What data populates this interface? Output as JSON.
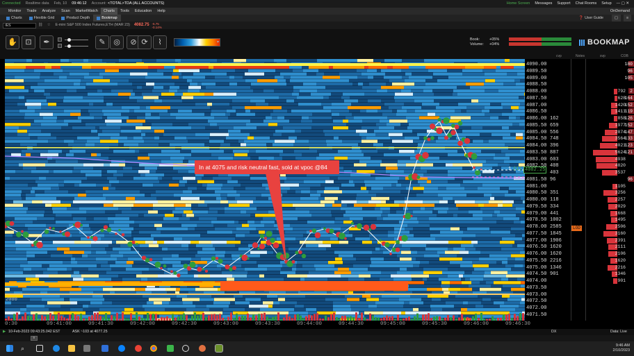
{
  "statusbar": {
    "connected": "Connected",
    "realtime": "Realtime data",
    "date": "Feb, 10",
    "time": "09:46:12",
    "account_label": "Account:",
    "account_value": "<TOTAL>TDA (ALL ACCOUNTS)",
    "home_screen": "Home Screen",
    "messages": "Messages",
    "support": "Support",
    "chat_rooms": "Chat Rooms",
    "setup": "Setup"
  },
  "menu": {
    "tabs": [
      "Monitor",
      "Trade",
      "Analyze",
      "Scan",
      "MarketWatch",
      "Charts",
      "Tools",
      "Education",
      "Help"
    ],
    "active": "Charts",
    "ondemand": "OnDemand"
  },
  "subtabs": {
    "items": [
      "Charts",
      "Flexible Grid",
      "Product Depth",
      "Bookmap"
    ],
    "active": "Bookmap",
    "user_guide": "User Guide"
  },
  "symbol": {
    "value": "/ES",
    "description": "E-mini S&P 500 Index Futures,ETH (MAR 23)",
    "price": "4082.75",
    "change_line1": "-5.75",
    "change_line2": "-0.14%"
  },
  "toolbar": {
    "icons": [
      "hand-icon",
      "crosshair-icon",
      "pin-icon",
      "pencil-icon",
      "ruler-icon",
      "volume-icon",
      "replay-icon",
      "chart-icon"
    ],
    "book_label": "Book:",
    "book_pct": "+05%",
    "volume_label": "Volume:",
    "volume_pct": "+04%",
    "logo": "BOOKMAP"
  },
  "colors": {
    "heat_low": "#04203f",
    "heat_mid": "#1e6fb0",
    "heat_high": "#ffffff",
    "heat_hot": "#ff6a00",
    "bid": "#d9343b",
    "ask": "#2e9c3d",
    "accent": "#3c7fc8"
  },
  "ladder": {
    "headers": {
      "cvp": "cvp",
      "notes": "Notes",
      "svp": "svp",
      "cob": "COB"
    },
    "prices": [
      "4090.00",
      "4089.50",
      "4089.00",
      "4088.50",
      "4088.00",
      "4087.50",
      "4087.00",
      "4086.50",
      "4086.00",
      "4085.50",
      "4085.00",
      "4084.50",
      "4084.00",
      "4083.50",
      "4083.00",
      "4082.50",
      "4082.00",
      "4081.50",
      "4081.00",
      "4080.50",
      "4080.00",
      "4079.50",
      "4079.00",
      "4078.50",
      "4078.00",
      "4077.50",
      "4077.00",
      "4076.50",
      "4076.00",
      "4075.50",
      "4075.00",
      "4074.50",
      "4074.00",
      "4073.50",
      "4073.00",
      "4072.50",
      "4072.00",
      "4071.50"
    ],
    "volumes": [
      "",
      "",
      "",
      "",
      "",
      "",
      "",
      "",
      "162",
      "659",
      "556",
      "748",
      "396",
      "887",
      "603",
      "408",
      "403",
      "96",
      "",
      "351",
      "118",
      "334",
      "441",
      "1002",
      "2585",
      "1845",
      "1906",
      "1620",
      "1620",
      "2216",
      "1346",
      "901",
      "",
      "",
      "",
      "",
      "",
      ""
    ],
    "svp": [
      "",
      "",
      "",
      "",
      "792",
      "628",
      "1420",
      "1411",
      "858",
      "1977",
      "2874",
      "3564",
      "4021",
      "5624",
      "4938",
      "4820",
      "3537",
      "",
      "1105",
      "3256",
      "2257",
      "2029",
      "1668",
      "1495",
      "2506",
      "3160",
      "2391",
      "2111",
      "2106",
      "1620",
      "2216",
      "1346",
      "901",
      "",
      "",
      "",
      "",
      ""
    ],
    "cob": [
      "180",
      "96",
      "105",
      "",
      "2",
      "164",
      "152",
      "119",
      "126",
      "152",
      "147",
      "133",
      "123",
      "121",
      "",
      "",
      "",
      "96",
      "",
      "",
      "",
      "",
      "",
      "",
      "",
      "",
      "",
      "",
      "",
      "",
      "",
      "",
      "",
      "",
      "",
      "",
      "",
      ""
    ],
    "current_price": "4082.25",
    "current_label": "(1)",
    "lod_label": "LOD",
    "annot_1": "1"
  },
  "callout": "In at 4075 and risk neutral fast, sold at vpoc @84",
  "volume_label": "2000",
  "time_axis": [
    "0:30",
    "09:41:00",
    "09:41:30",
    "09:42:00",
    "09:42:30",
    "09:43:00",
    "09:43:30",
    "09:44:00",
    "09:44:30",
    "09:45:00",
    "09:45:30",
    "09:46:00",
    "09:46:30"
  ],
  "bottom": {
    "date_time": "10-Feb-2023 09:43:25.042 EST",
    "ask_info": "ASK ~103 at 4077.25",
    "dx": "DX",
    "data_status": "Data: Live"
  },
  "taskbar": {
    "time": "9:46 AM",
    "date": "2/10/2023"
  }
}
